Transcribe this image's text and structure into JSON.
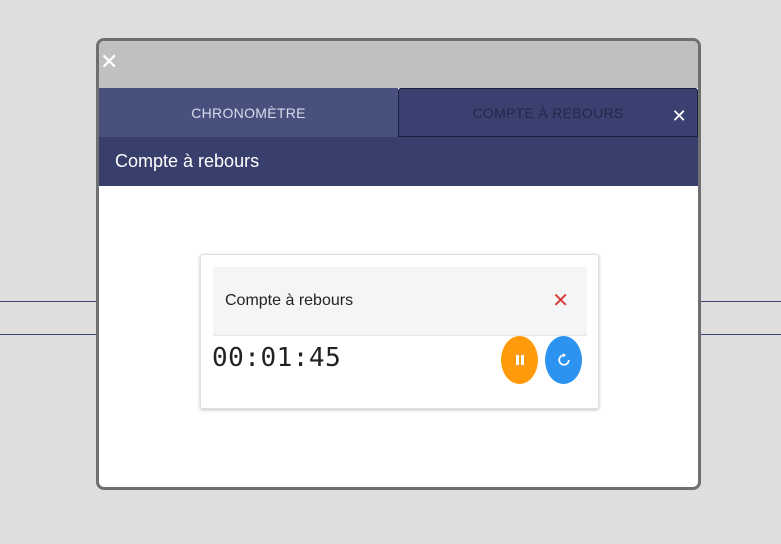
{
  "window": {
    "close_icon": "close-icon"
  },
  "tabs": [
    {
      "label": "CHRONOMÈTRE",
      "active": true
    },
    {
      "label": "COMPTE À REBOURS",
      "active": false,
      "close_icon": "close-icon"
    }
  ],
  "header": {
    "title": "Compte à rebours"
  },
  "timer": {
    "title": "Compte à rebours",
    "time": "00:01:45",
    "remove_icon": "close-icon",
    "pause_icon": "pause-icon",
    "reset_icon": "refresh-icon"
  },
  "colors": {
    "accent": "#393f6c",
    "pause": "#ff9a0a",
    "reset": "#2c94f0",
    "remove": "#d63a3a"
  }
}
